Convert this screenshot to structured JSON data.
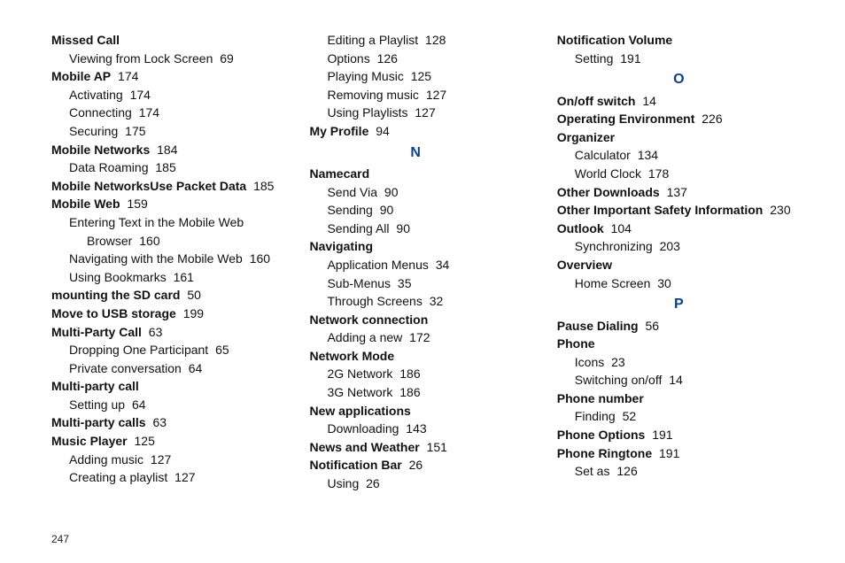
{
  "page_number": "247",
  "columns": [
    [
      {
        "text": "Missed Call",
        "bold": true,
        "indent": 0
      },
      {
        "text": "Viewing from Lock Screen",
        "page": "69",
        "indent": 1
      },
      {
        "text": "Mobile AP",
        "page": "174",
        "bold": true,
        "indent": 0
      },
      {
        "text": "Activating",
        "page": "174",
        "indent": 1
      },
      {
        "text": "Connecting",
        "page": "174",
        "indent": 1
      },
      {
        "text": "Securing",
        "page": "175",
        "indent": 1
      },
      {
        "text": "Mobile Networks",
        "page": "184",
        "bold": true,
        "indent": 0
      },
      {
        "text": "Data Roaming",
        "page": "185",
        "indent": 1
      },
      {
        "text": "Mobile NetworksUse Packet Data",
        "page": "185",
        "bold": true,
        "indent": 0
      },
      {
        "text": "Mobile Web",
        "page": "159",
        "bold": true,
        "indent": 0
      },
      {
        "text": "Entering Text in the Mobile Web",
        "indent": 1
      },
      {
        "text": "Browser",
        "page": "160",
        "indent": 2
      },
      {
        "text": "Navigating with the Mobile Web",
        "page": "160",
        "indent": 1
      },
      {
        "text": "Using Bookmarks",
        "page": "161",
        "indent": 1
      },
      {
        "text": "mounting the SD card",
        "page": "50",
        "bold": true,
        "indent": 0
      },
      {
        "text": "Move to USB storage",
        "page": "199",
        "bold": true,
        "indent": 0
      },
      {
        "text": "Multi-Party Call",
        "page": "63",
        "bold": true,
        "indent": 0
      },
      {
        "text": "Dropping One Participant",
        "page": "65",
        "indent": 1
      },
      {
        "text": "Private conversation",
        "page": "64",
        "indent": 1
      },
      {
        "text": "Multi-party call",
        "bold": true,
        "indent": 0
      },
      {
        "text": "Setting up",
        "page": "64",
        "indent": 1
      },
      {
        "text": "Multi-party calls",
        "page": "63",
        "bold": true,
        "indent": 0
      },
      {
        "text": "Music Player",
        "page": "125",
        "bold": true,
        "indent": 0
      },
      {
        "text": "Adding music",
        "page": "127",
        "indent": 1
      },
      {
        "text": "Creating a playlist",
        "page": "127",
        "indent": 1
      }
    ],
    [
      {
        "text": "Editing a Playlist",
        "page": "128",
        "indent": 1
      },
      {
        "text": "Options",
        "page": "126",
        "indent": 1
      },
      {
        "text": "Playing Music",
        "page": "125",
        "indent": 1
      },
      {
        "text": "Removing music",
        "page": "127",
        "indent": 1
      },
      {
        "text": "Using Playlists",
        "page": "127",
        "indent": 1
      },
      {
        "text": "My Profile",
        "page": "94",
        "bold": true,
        "indent": 0
      },
      {
        "letter": "N"
      },
      {
        "text": "Namecard",
        "bold": true,
        "indent": 0
      },
      {
        "text": "Send Via",
        "page": "90",
        "indent": 1
      },
      {
        "text": "Sending",
        "page": "90",
        "indent": 1
      },
      {
        "text": "Sending All",
        "page": "90",
        "indent": 1
      },
      {
        "text": "Navigating",
        "bold": true,
        "indent": 0
      },
      {
        "text": "Application Menus",
        "page": "34",
        "indent": 1
      },
      {
        "text": "Sub-Menus",
        "page": "35",
        "indent": 1
      },
      {
        "text": "Through Screens",
        "page": "32",
        "indent": 1
      },
      {
        "text": "Network connection",
        "bold": true,
        "indent": 0
      },
      {
        "text": "Adding a new",
        "page": "172",
        "indent": 1
      },
      {
        "text": "Network Mode",
        "bold": true,
        "indent": 0
      },
      {
        "text": "2G Network",
        "page": "186",
        "indent": 1
      },
      {
        "text": "3G Network",
        "page": "186",
        "indent": 1
      },
      {
        "text": "New applications",
        "bold": true,
        "indent": 0
      },
      {
        "text": "Downloading",
        "page": "143",
        "indent": 1
      },
      {
        "text": "News and Weather",
        "page": "151",
        "bold": true,
        "indent": 0
      },
      {
        "text": "Notification Bar",
        "page": "26",
        "bold": true,
        "indent": 0
      },
      {
        "text": "Using",
        "page": "26",
        "indent": 1
      }
    ],
    [
      {
        "text": "Notification Volume",
        "bold": true,
        "indent": 0
      },
      {
        "text": "Setting",
        "page": "191",
        "indent": 1
      },
      {
        "letter": "O"
      },
      {
        "text": "On/off switch",
        "page": "14",
        "bold": true,
        "indent": 0
      },
      {
        "text": "Operating Environment",
        "page": "226",
        "bold": true,
        "indent": 0
      },
      {
        "text": "Organizer",
        "bold": true,
        "indent": 0
      },
      {
        "text": "Calculator",
        "page": "134",
        "indent": 1
      },
      {
        "text": "World Clock",
        "page": "178",
        "indent": 1
      },
      {
        "text": "Other Downloads",
        "page": "137",
        "bold": true,
        "indent": 0
      },
      {
        "text": "Other Important Safety Information",
        "page": "230",
        "bold": true,
        "indent": 0
      },
      {
        "text": "Outlook",
        "page": "104",
        "bold": true,
        "indent": 0
      },
      {
        "text": "Synchronizing",
        "page": "203",
        "indent": 1
      },
      {
        "text": "Overview",
        "bold": true,
        "indent": 0
      },
      {
        "text": "Home Screen",
        "page": "30",
        "indent": 1
      },
      {
        "letter": "P"
      },
      {
        "text": "Pause Dialing",
        "page": "56",
        "bold": true,
        "indent": 0
      },
      {
        "text": "Phone",
        "bold": true,
        "indent": 0
      },
      {
        "text": "Icons",
        "page": "23",
        "indent": 1
      },
      {
        "text": "Switching on/off",
        "page": "14",
        "indent": 1
      },
      {
        "text": "Phone number",
        "bold": true,
        "indent": 0
      },
      {
        "text": "Finding",
        "page": "52",
        "indent": 1
      },
      {
        "text": "Phone Options",
        "page": "191",
        "bold": true,
        "indent": 0
      },
      {
        "text": "Phone Ringtone",
        "page": "191",
        "bold": true,
        "indent": 0
      },
      {
        "text": "Set as",
        "page": "126",
        "indent": 1
      }
    ]
  ]
}
